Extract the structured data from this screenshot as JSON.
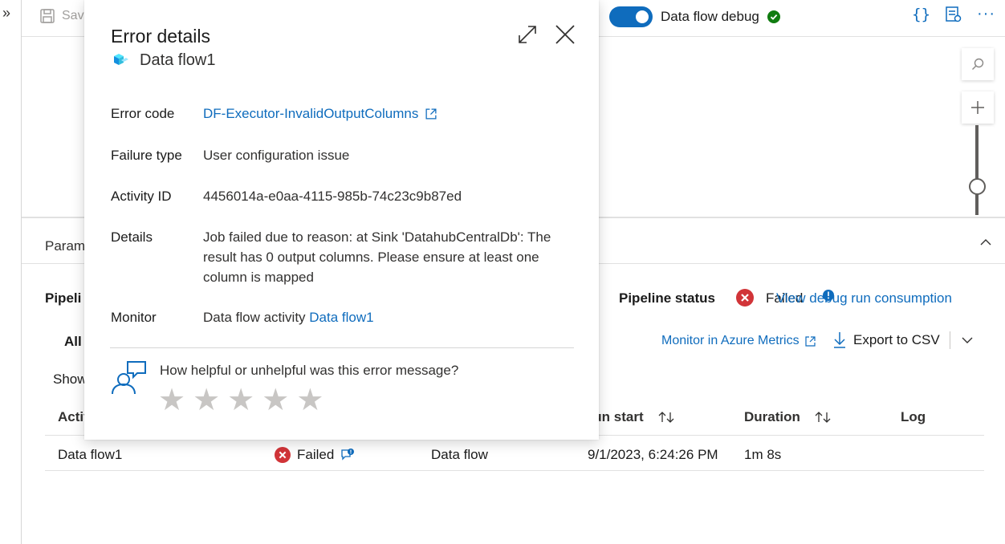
{
  "toolbar": {
    "save_label": "Save",
    "debug_label": "Data flow debug"
  },
  "dialog": {
    "title": "Error details",
    "subtitle": "Data flow1",
    "error_code_label": "Error code",
    "error_code_value": "DF-Executor-InvalidOutputColumns",
    "failure_type_label": "Failure type",
    "failure_type_value": "User configuration issue",
    "activity_id_label": "Activity ID",
    "activity_id_value": "4456014a-e0aa-4115-985b-74c23c9b87ed",
    "details_label": "Details",
    "details_value": "Job failed due to reason: at Sink 'DatahubCentralDb': The result has 0 output columns. Please ensure at least one column is mapped",
    "monitor_label": "Monitor",
    "monitor_prefix": "Data flow activity",
    "monitor_link": "Data flow1",
    "feedback_question": "How helpful or unhelpful was this error message?",
    "rating_stars": 5
  },
  "panel": {
    "params_tab": "Param",
    "pipeline_heading": "Pipeli",
    "pipeline_status_label": "Pipeline status",
    "pipeline_status_value": "Failed",
    "consumption_link": "View debug run consumption",
    "all_tab": "All",
    "show_text": "Show",
    "monitor_azure": "Monitor in Azure Metrics",
    "export_csv": "Export to CSV",
    "columns": {
      "activity": "Activ",
      "run_start": "Run start",
      "duration": "Duration",
      "log": "Log"
    },
    "rows": [
      {
        "activity": "Data flow1",
        "status": "Failed",
        "type": "Data flow",
        "run_start": "9/1/2023, 6:24:26 PM",
        "duration": "1m 8s"
      }
    ]
  },
  "colors": {
    "accent": "#0f6cbd",
    "error": "#d13438",
    "success": "#107c10"
  }
}
